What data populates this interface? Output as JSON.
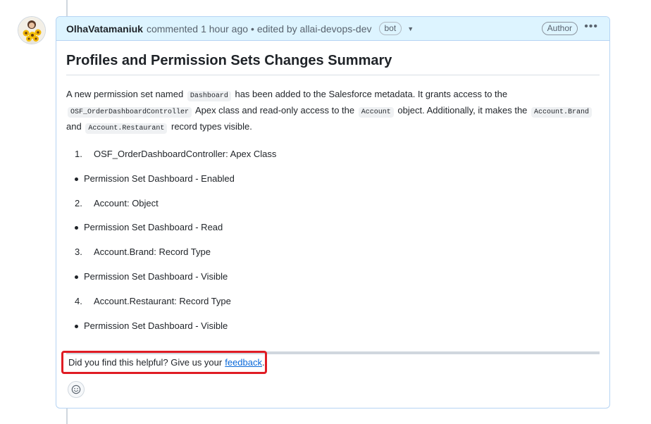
{
  "comment": {
    "author": "OlhaVatamaniuk",
    "action": "commented",
    "time": "1 hour ago",
    "edited": "• edited by allai-devops-dev",
    "bot_badge": "bot",
    "author_badge": "Author",
    "menu_icon": "kebab-horizontal-icon"
  },
  "body": {
    "title": "Profiles and Permission Sets Changes Summary",
    "summary": {
      "t1": "A new permission set named",
      "c1": "Dashboard",
      "t2": "has been added to the Salesforce metadata. It grants access to the",
      "c2": "OSF_OrderDashboardController",
      "t3": "Apex class and read-only access to the",
      "c3": "Account",
      "t4": "object. Additionally, it makes the",
      "c4": "Account.Brand",
      "t5": "and",
      "c5": "Account.Restaurant",
      "t6": "record types visible."
    },
    "items": [
      {
        "type": "numbered",
        "marker": "1.",
        "text": "OSF_OrderDashboardController: Apex Class"
      },
      {
        "type": "bullet",
        "text": "Permission Set Dashboard - Enabled"
      },
      {
        "type": "numbered",
        "marker": "2.",
        "text": "Account: Object"
      },
      {
        "type": "bullet",
        "text": "Permission Set Dashboard - Read"
      },
      {
        "type": "numbered",
        "marker": "3.",
        "text": "Account.Brand: Record Type"
      },
      {
        "type": "bullet",
        "text": "Permission Set Dashboard - Visible"
      },
      {
        "type": "numbered",
        "marker": "4.",
        "text": "Account.Restaurant: Record Type"
      },
      {
        "type": "bullet",
        "text": "Permission Set Dashboard - Visible"
      }
    ]
  },
  "feedback": {
    "text": "Did you find this helpful? Give us your",
    "link": "feedback",
    "end": ".",
    "highlight_color": "#e01c24"
  },
  "reaction_icon": "smiley-icon"
}
